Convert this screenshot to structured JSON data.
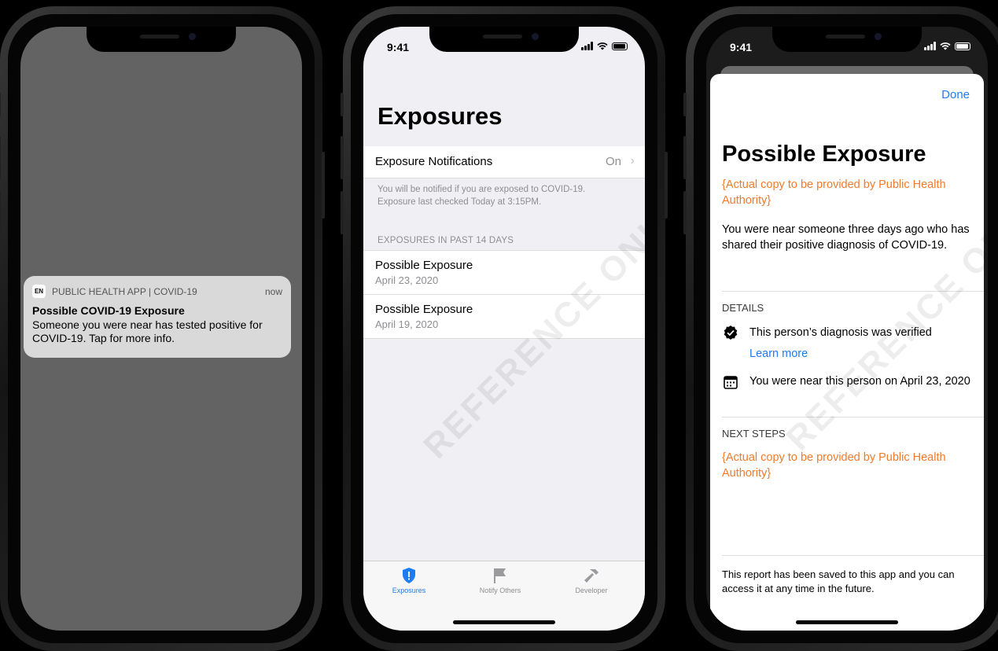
{
  "phone1": {
    "notification": {
      "app_badge": "EN",
      "app_name": "PUBLIC HEALTH APP | COVID-19",
      "time": "now",
      "title": "Possible COVID-19 Exposure",
      "body": "Someone you were near has tested positive for COVID-19. Tap for more info."
    }
  },
  "phone2": {
    "status_time": "9:41",
    "title": "Exposures",
    "exposure_notifications_label": "Exposure Notifications",
    "exposure_notifications_value": "On",
    "footnote_line1": "You will be notified if you are exposed to COVID-19.",
    "footnote_line2": "Exposure last checked Today at 3:15PM.",
    "section_header": "EXPOSURES IN PAST 14 DAYS",
    "exposures": [
      {
        "title": "Possible Exposure",
        "date": "April 23, 2020"
      },
      {
        "title": "Possible Exposure",
        "date": "April 19, 2020"
      }
    ],
    "tabs": [
      {
        "label": "Exposures",
        "icon": "shield-alert-icon",
        "active": true
      },
      {
        "label": "Notify Others",
        "icon": "flag-icon",
        "active": false
      },
      {
        "label": "Developer",
        "icon": "hammer-icon",
        "active": false
      }
    ],
    "watermark": "REFERENCE ONLY"
  },
  "phone3": {
    "status_time": "9:41",
    "done_label": "Done",
    "title": "Possible Exposure",
    "placeholder_copy_1": "{Actual copy to be provided by Public Health Authority}",
    "body": "You were near someone three days ago who has shared their positive diagnosis of COVID-19.",
    "details_header": "DETAILS",
    "detail_verified": "This person’s diagnosis was verified",
    "learn_more": "Learn more",
    "detail_date": "You were near this person on April 23, 2020",
    "next_steps_header": "NEXT STEPS",
    "placeholder_copy_2": "{Actual copy to be provided by Public Health Authority}",
    "footer": "This report has been saved to this app and you can access it at any time in the future.",
    "watermark": "REFERENCE ONLY"
  },
  "colors": {
    "accent_blue": "#1d7cf2",
    "placeholder_orange": "#f37a2a",
    "lock_screen_gray": "#636363"
  }
}
